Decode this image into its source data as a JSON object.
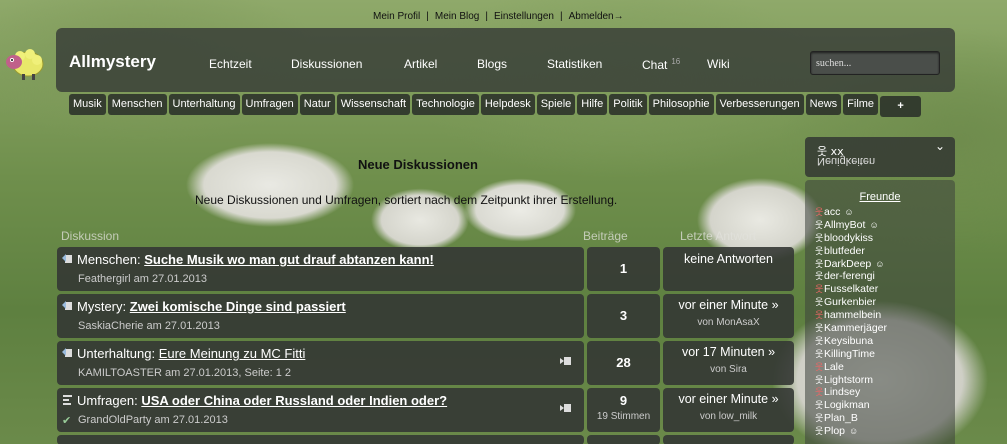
{
  "toplinks": [
    "Mein Profil",
    "Mein Blog",
    "Einstellungen",
    "Abmelden"
  ],
  "logout_icon": "arrow-right-icon",
  "header": {
    "brand": "Allmystery",
    "nav": [
      {
        "label": "Echtzeit"
      },
      {
        "label": "Diskussionen"
      },
      {
        "label": "Artikel"
      },
      {
        "label": "Blogs"
      },
      {
        "label": "Statistiken"
      },
      {
        "label": "Chat",
        "badge": "16"
      },
      {
        "label": "Wiki"
      }
    ],
    "search_placeholder": "suchen..."
  },
  "categories": [
    "Musik",
    "Menschen",
    "Unterhaltung",
    "Umfragen",
    "Natur",
    "Wissenschaft",
    "Technologie",
    "Helpdesk",
    "Spiele",
    "Hilfe",
    "Politik",
    "Philosophie",
    "Verbesserungen",
    "News",
    "Filme"
  ],
  "categories_more": "+",
  "main": {
    "title": "Neue Diskussionen",
    "subtitle": "Neue Diskussionen und Umfragen, sortiert nach dem Zeitpunkt ihrer Erstellung.",
    "columns": [
      "Diskussion",
      "Beiträge",
      "Letzte Antwort"
    ],
    "rows": [
      {
        "category": "Menschen:",
        "title": "Suche Musik wo man gut drauf abtanzen kann!",
        "bold": true,
        "meta": "Feathergirl am 27.01.2013",
        "count": "1",
        "count_sub": "",
        "last": "keine Antworten",
        "last_by": "",
        "page_icon": false,
        "check": false
      },
      {
        "category": "Mystery:",
        "title": "Zwei komische Dinge sind passiert",
        "bold": true,
        "meta": "SaskiaCherie am 27.01.2013",
        "count": "3",
        "count_sub": "",
        "last": "vor einer Minute »",
        "last_by": "von MonAsaX",
        "page_icon": false,
        "check": false
      },
      {
        "category": "Unterhaltung:",
        "title": "Eure Meinung zu MC Fitti",
        "bold": false,
        "meta": "KAMILTOASTER am 27.01.2013, Seite: 1 2",
        "count": "28",
        "count_sub": "",
        "last": "vor 17 Minuten »",
        "last_by": "von Sira",
        "page_icon": true,
        "check": false
      },
      {
        "category": "Umfragen:",
        "title": "USA oder China oder Russland oder Indien oder?",
        "bold": true,
        "meta": "GrandOldParty am 27.01.2013",
        "count": "9",
        "count_sub": "19 Stimmen",
        "last": "vor einer Minute »",
        "last_by": "von low_milk",
        "page_icon": true,
        "check": true
      }
    ]
  },
  "sidebar": {
    "user_label": "xx",
    "user_label_flipped": "Neuigkeiten",
    "friends_title": "Freunde",
    "friends": [
      {
        "name": "acc",
        "online": false,
        "cam": true
      },
      {
        "name": "AllmyBot",
        "online": true,
        "cam": true
      },
      {
        "name": "bloodykiss",
        "online": true,
        "cam": false
      },
      {
        "name": "blutfeder",
        "online": true,
        "cam": false
      },
      {
        "name": "DarkDeep",
        "online": true,
        "cam": true
      },
      {
        "name": "der-ferengi",
        "online": true,
        "cam": false
      },
      {
        "name": "Fusselkater",
        "online": false,
        "cam": false
      },
      {
        "name": "Gurkenbier",
        "online": true,
        "cam": false
      },
      {
        "name": "hammelbein",
        "online": false,
        "cam": false
      },
      {
        "name": "Kammerjäger",
        "online": true,
        "cam": false
      },
      {
        "name": "Keysibuna",
        "online": true,
        "cam": false
      },
      {
        "name": "KillingTime",
        "online": true,
        "cam": false
      },
      {
        "name": "Lale",
        "online": false,
        "cam": false
      },
      {
        "name": "Lightstorm",
        "online": true,
        "cam": false
      },
      {
        "name": "Lindsey",
        "online": false,
        "cam": false
      },
      {
        "name": "Logikman",
        "online": true,
        "cam": false
      },
      {
        "name": "Plan_B",
        "online": true,
        "cam": false
      },
      {
        "name": "Plop",
        "online": true,
        "cam": true
      }
    ]
  }
}
